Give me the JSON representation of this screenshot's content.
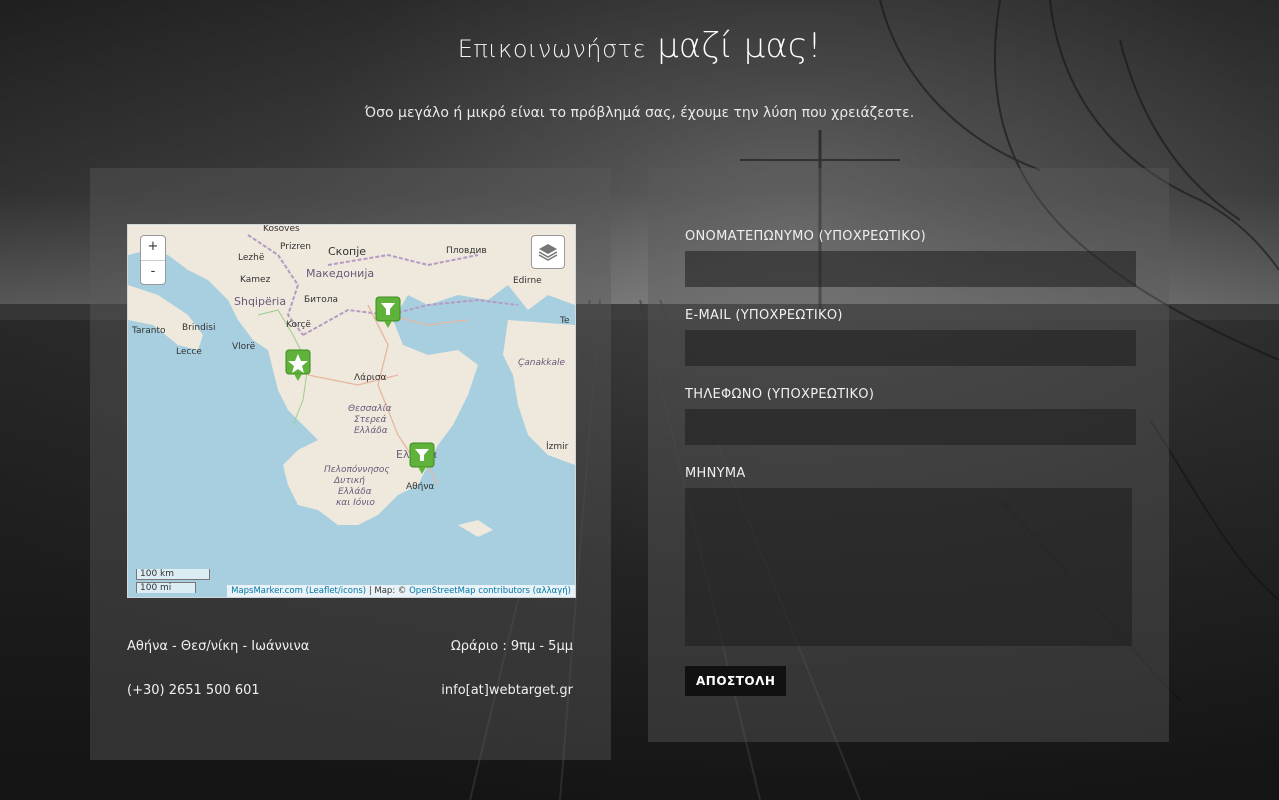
{
  "header": {
    "title_part1": "Επικοινωνήστε",
    "title_part2": "μαζί μας!",
    "subtitle": "Όσο μεγάλο ή μικρό είναι το πρόβλημά σας, έχουμε την λύση που χρειάζεστε."
  },
  "map": {
    "zoom_in_label": "+",
    "zoom_out_label": "-",
    "layers_icon": "layers-icon",
    "scale_km": "100 km",
    "scale_mi": "100 mi",
    "attribution_part1": "MapsMarker.com",
    "attribution_part2": "(Leaflet/icons)",
    "attribution_part3": "| Map: ©",
    "attribution_part4": "OpenStreetMap contributors",
    "attribution_part5": "(αλλαγή)",
    "place_labels": [
      "Kosovës",
      "Prizren",
      "Скопје",
      "Пловдив",
      "Lezhë",
      "Македонија",
      "Edirne",
      "Kamez",
      "Shqipëria",
      "Битола",
      "Korçë",
      "Taranto",
      "Brindisi",
      "Lecce",
      "Vlorë",
      "Λάρισα",
      "Θεσσαλία",
      "Στερεά",
      "Ελλάδα",
      "Çanakkale",
      "Ελλάδα",
      "Πελοπόννησος",
      "Δυτική",
      "Ελλάδα",
      "και Ιόνιο",
      "Αθήνα",
      "İzmir",
      "Te"
    ],
    "marker_icons": [
      "pin-marker-icon",
      "star-marker-icon",
      "pin-marker-icon"
    ]
  },
  "contact_info": {
    "cities": "Αθήνα - Θεσ/νίκη - Ιωάννινα",
    "hours": "Ωράριο : 9πμ - 5μμ",
    "phone": "(+30) 2651 500 601",
    "email": "info[at]webtarget.gr"
  },
  "form": {
    "name_label": "ΟΝΟΜΑΤΕΠΩΝΥΜΟ (ΥΠΟΧΡΕΩΤΙΚΟ)",
    "name_value": "",
    "email_label": "E-MAIL (ΥΠΟΧΡΕΩΤΙΚΟ)",
    "email_value": "",
    "phone_label": "ΤΗΛΕΦΩΝΟ (ΥΠΟΧΡΕΩΤΙΚΟ)",
    "phone_value": "",
    "message_label": "ΜΗΝΥΜΑ",
    "message_value": "",
    "submit_label": "ΑΠΟΣΤΟΛΗ"
  }
}
